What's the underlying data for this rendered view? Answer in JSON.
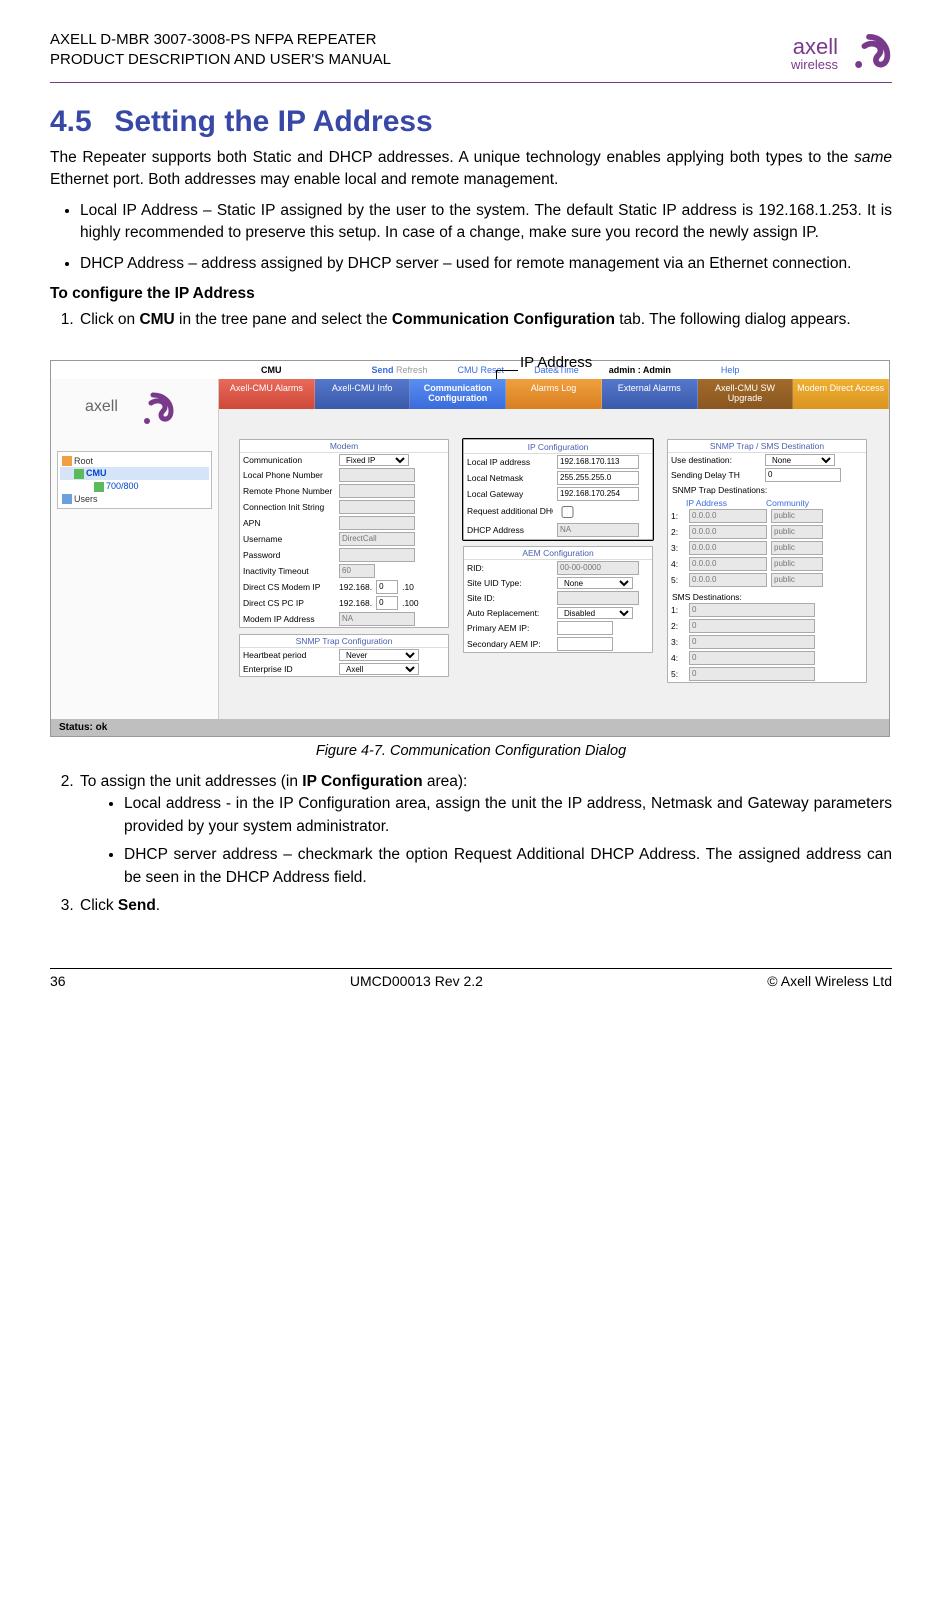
{
  "header": {
    "line1": "AXELL D-MBR 3007-3008-PS NFPA REPEATER",
    "line2": "PRODUCT DESCRIPTION AND USER'S MANUAL",
    "logo_top": "axell",
    "logo_bottom": "wireless"
  },
  "section": {
    "number": "4.5",
    "title": "Setting the IP Address"
  },
  "intro": "The Repeater supports both Static and DHCP addresses. A unique technology enables applying both types to the same Ethernet port. Both addresses may enable local and remote management.",
  "intro_em": "same",
  "bullet1": "Local IP Address – Static IP assigned by the user to the system. The default Static IP address is 192.168.1.253. It is highly recommended to preserve this setup. In case of a change, make sure you record the newly assign IP.",
  "bullet2": "DHCP Address – address assigned by DHCP server – used for remote management via an Ethernet connection.",
  "subhead": "To configure the IP Address",
  "step1_a": "Click on ",
  "step1_b": "CMU",
  "step1_c": " in the tree pane and select the ",
  "step1_d": "Communication Configuration",
  "step1_e": " tab. The following dialog appears.",
  "callout": "IP Address",
  "shot": {
    "topbar": {
      "title": "CMU",
      "send": "Send",
      "refresh": "Refresh",
      "reset": "CMU Reset",
      "datetime": "Date&Time",
      "admin": "admin : Admin",
      "help": "Help"
    },
    "tabs": {
      "t1": "Axell-CMU Alarms",
      "t2": "Axell-CMU Info",
      "t3": "Communication Configuration",
      "t4": "Alarms Log",
      "t5": "External Alarms",
      "t6": "Axell-CMU SW Upgrade",
      "t7": "Modem Direct Access"
    },
    "tree": {
      "root": "Root",
      "cmu": "CMU",
      "band": "700/800",
      "users": "Users"
    },
    "modem": {
      "title": "Modem",
      "l1": "Communication",
      "v1": "Fixed IP",
      "l2": "Local Phone Number",
      "l3": "Remote Phone Number",
      "l4": "Connection Init String",
      "l5": "APN",
      "l6": "Username",
      "v6": "DirectCall",
      "l7": "Password",
      "l8": "Inactivity Timeout",
      "v8": "60",
      "l9": "Direct CS Modem IP",
      "v9a": "192.168.",
      "v9b": "0",
      "v9c": ".10",
      "l10": "Direct CS PC IP",
      "v10a": "192.168.",
      "v10b": "0",
      "v10c": ".100",
      "l11": "Modem IP Address",
      "v11": "NA"
    },
    "snmptrap": {
      "title": "SNMP Trap Configuration",
      "l1": "Heartbeat period",
      "v1": "Never",
      "l2": "Enterprise ID",
      "v2": "Axell"
    },
    "ipconf": {
      "title": "IP Configuration",
      "l1": "Local IP address",
      "v1": "192.168.170.113",
      "l2": "Local Netmask",
      "v2": "255.255.255.0",
      "l3": "Local Gateway",
      "v3": "192.168.170.254",
      "l4": "Request additional DHCP address",
      "l5": "DHCP Address",
      "v5": "NA"
    },
    "aem": {
      "title": "AEM Configuration",
      "l1": "RID:",
      "v1": "00-00-0000",
      "l2": "Site UID Type:",
      "v2": "None",
      "l3": "Site ID:",
      "l4": "Auto Replacement:",
      "v4": "Disabled",
      "l5": "Primary AEM IP:",
      "l6": "Secondary AEM IP:"
    },
    "snmpdest": {
      "title": "SNMP Trap / SMS Destination",
      "l1": "Use destination:",
      "v1": "None",
      "l2": "Sending Delay TH",
      "v2": "0",
      "sub": "SNMP Trap Destinations:",
      "h1": "IP Address",
      "h2": "Community",
      "ip": "0.0.0.0",
      "comm": "public",
      "smslbl": "SMS Destinations:",
      "sms": "0"
    },
    "status": "Status: ok"
  },
  "caption": "Figure 4-7. Communication Configuration Dialog",
  "step2_a": "To assign the unit addresses (in ",
  "step2_b": "IP Configuration",
  "step2_c": " area):",
  "sub1": "Local address - in the IP Configuration area, assign the unit the IP address, Netmask and Gateway parameters provided by your system administrator.",
  "sub2": "DHCP server address – checkmark the option Request Additional DHCP Address. The assigned address can be seen in the DHCP Address field.",
  "step3_a": "Click ",
  "step3_b": "Send",
  "step3_c": ".",
  "footer": {
    "page": "36",
    "rev": "UMCD00013 Rev 2.2",
    "copy": "© Axell Wireless Ltd"
  }
}
